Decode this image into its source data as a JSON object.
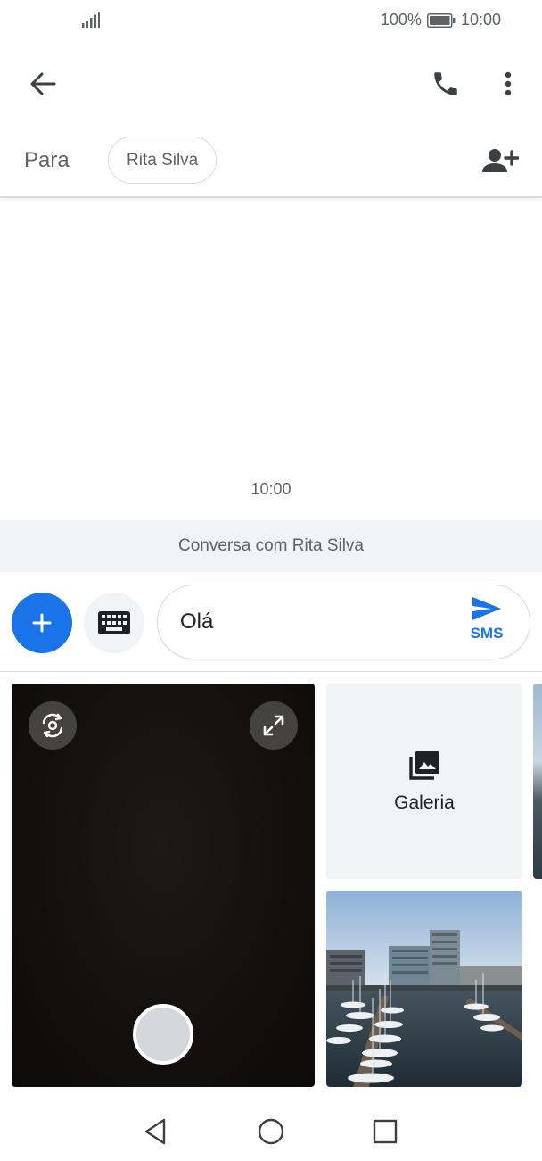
{
  "status_bar": {
    "battery_percent": "100%",
    "time": "10:00",
    "icons": [
      "signal-icon",
      "battery-icon"
    ]
  },
  "app_bar": {
    "icons": [
      "back-arrow-icon",
      "phone-icon",
      "more-vert-icon"
    ]
  },
  "recipient": {
    "to_label": "Para",
    "chip_name": "Rita Silva",
    "add_icon": "add-person-icon"
  },
  "conversation": {
    "timestamp": "10:00",
    "info": "Conversa com Rita Silva"
  },
  "compose": {
    "message_text": "Olá",
    "send_label": "SMS",
    "icons": [
      "plus-icon",
      "keyboard-icon",
      "send-icon"
    ],
    "colors": {
      "accent": "#1a73e8"
    }
  },
  "media": {
    "gallery_label": "Galeria",
    "icons": [
      "switch-camera-icon",
      "expand-icon",
      "shutter-button",
      "gallery-icon"
    ]
  },
  "nav_bar": {
    "icons": [
      "nav-back-icon",
      "nav-home-icon",
      "nav-recents-icon"
    ]
  }
}
